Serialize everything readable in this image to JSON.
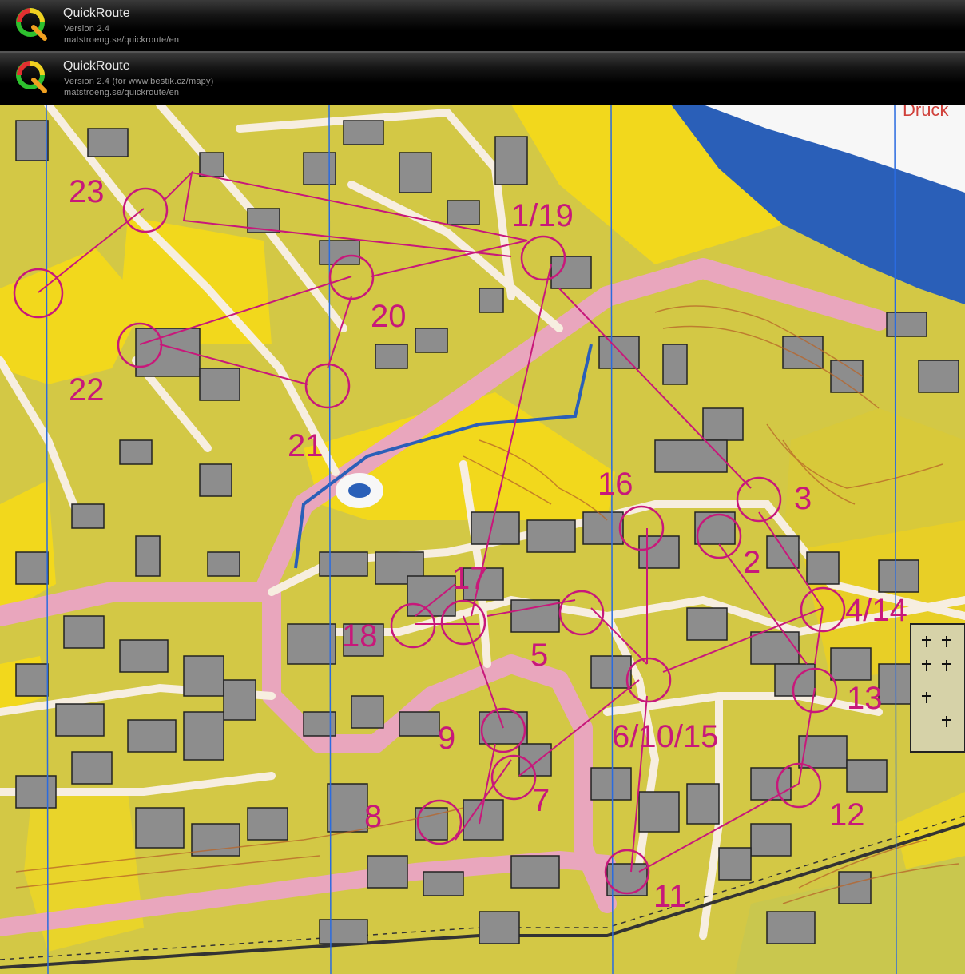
{
  "header_primary": {
    "app_name": "QuickRoute",
    "version": "Version 2.4",
    "url": "matstroeng.se/quickroute/en"
  },
  "header_secondary": {
    "app_name": "QuickRoute",
    "version": "Version 2.4  (for www.bestik.cz/mapy)",
    "url": "matstroeng.se/quickroute/en"
  },
  "map": {
    "corner_text": "Druck",
    "colors": {
      "course": "#c8187a",
      "yellow": "#f4de1c",
      "olive": "#c9c23c",
      "building": "#8d8d8d",
      "road": "#e9a6bd",
      "water": "#2a5fb8",
      "paper": "#f3ebd6"
    },
    "controls": [
      {
        "label": "23"
      },
      {
        "label": "1/19"
      },
      {
        "label": "20"
      },
      {
        "label": "22"
      },
      {
        "label": "21"
      },
      {
        "label": "16"
      },
      {
        "label": "3"
      },
      {
        "label": "2"
      },
      {
        "label": "17"
      },
      {
        "label": "4/14"
      },
      {
        "label": "18"
      },
      {
        "label": "5"
      },
      {
        "label": "13"
      },
      {
        "label": "9"
      },
      {
        "label": "6/10/15"
      },
      {
        "label": "7"
      },
      {
        "label": "12"
      },
      {
        "label": "8"
      },
      {
        "label": "11"
      }
    ]
  }
}
